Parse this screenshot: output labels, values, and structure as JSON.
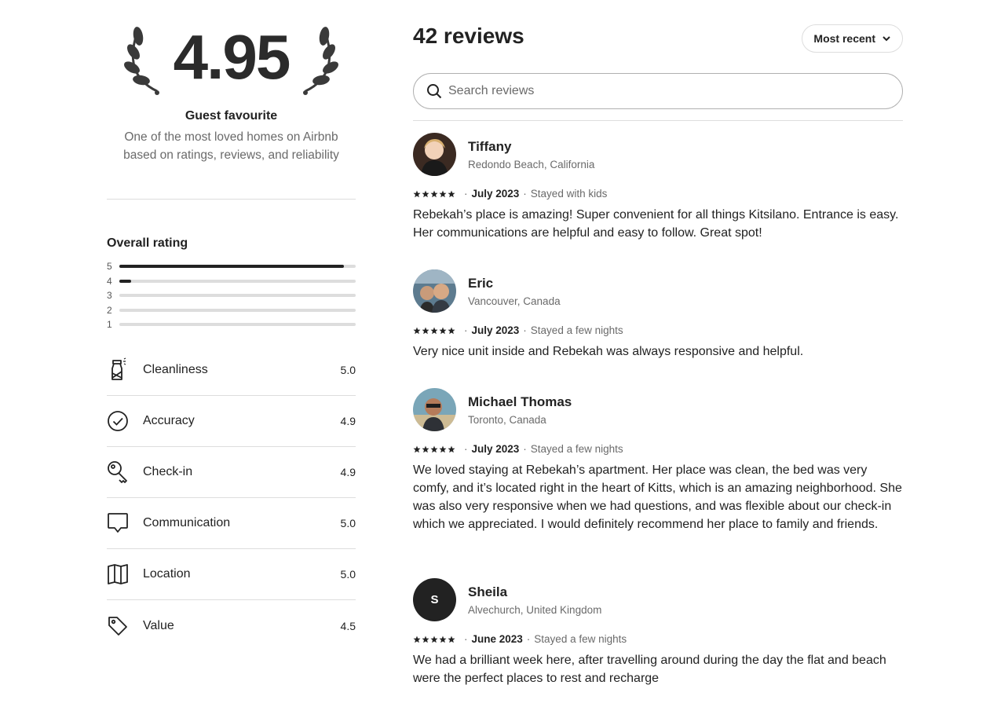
{
  "summary": {
    "rating": "4.95",
    "title": "Guest favourite",
    "description": "One of the most loved homes on Airbnb based on ratings, reviews, and reliability"
  },
  "overall": {
    "title": "Overall rating",
    "distribution": [
      {
        "stars": "5",
        "fraction": 0.95
      },
      {
        "stars": "4",
        "fraction": 0.05
      },
      {
        "stars": "3",
        "fraction": 0
      },
      {
        "stars": "2",
        "fraction": 0
      },
      {
        "stars": "1",
        "fraction": 0
      }
    ]
  },
  "categories": [
    {
      "label": "Cleanliness",
      "value": "5.0",
      "icon": "spray-bottle-icon"
    },
    {
      "label": "Accuracy",
      "value": "4.9",
      "icon": "check-circle-icon"
    },
    {
      "label": "Check-in",
      "value": "4.9",
      "icon": "key-icon"
    },
    {
      "label": "Communication",
      "value": "5.0",
      "icon": "message-icon"
    },
    {
      "label": "Location",
      "value": "5.0",
      "icon": "map-icon"
    },
    {
      "label": "Value",
      "value": "4.5",
      "icon": "tag-icon"
    }
  ],
  "reviews_header": {
    "title": "42 reviews",
    "sort_label": "Most recent",
    "search_placeholder": "Search reviews"
  },
  "reviews": [
    {
      "name": "Tiffany",
      "location": "Redondo Beach, California",
      "rating": 5,
      "date": "July 2023",
      "stay": "Stayed with kids",
      "text": "Rebekah’s place is amazing! Super convenient for all things Kitsilano. Entrance is easy. Her communications are helpful and easy to follow. Great spot!",
      "avatar": "photo"
    },
    {
      "name": "Eric",
      "location": "Vancouver, Canada",
      "rating": 5,
      "date": "July 2023",
      "stay": "Stayed a few nights",
      "text": "Very nice unit inside and Rebekah was always responsive and helpful.",
      "avatar": "photo"
    },
    {
      "name": "Michael Thomas",
      "location": "Toronto, Canada",
      "rating": 5,
      "date": "July 2023",
      "stay": "Stayed a few nights",
      "text": "We loved staying at Rebekah’s apartment. Her place was clean, the bed was very comfy, and it’s located right in the heart of Kitts, which is an amazing neighborhood. She was also very responsive when we had questions, and was flexible about our check-in which we appreciated. I would definitely recommend her place to family and friends.",
      "avatar": "photo"
    },
    {
      "name": "Sheila",
      "location": "Alvechurch, United Kingdom",
      "rating": 5,
      "date": "June 2023",
      "stay": "Stayed a few nights",
      "text": "We had a brilliant week here, after travelling around during the day the flat and beach were the perfect places to rest and recharge",
      "avatar": "S"
    }
  ],
  "colors": {
    "text": "#222222",
    "muted": "#6a6a6a",
    "divider": "#dddddd",
    "bar_fill": "#222222"
  }
}
